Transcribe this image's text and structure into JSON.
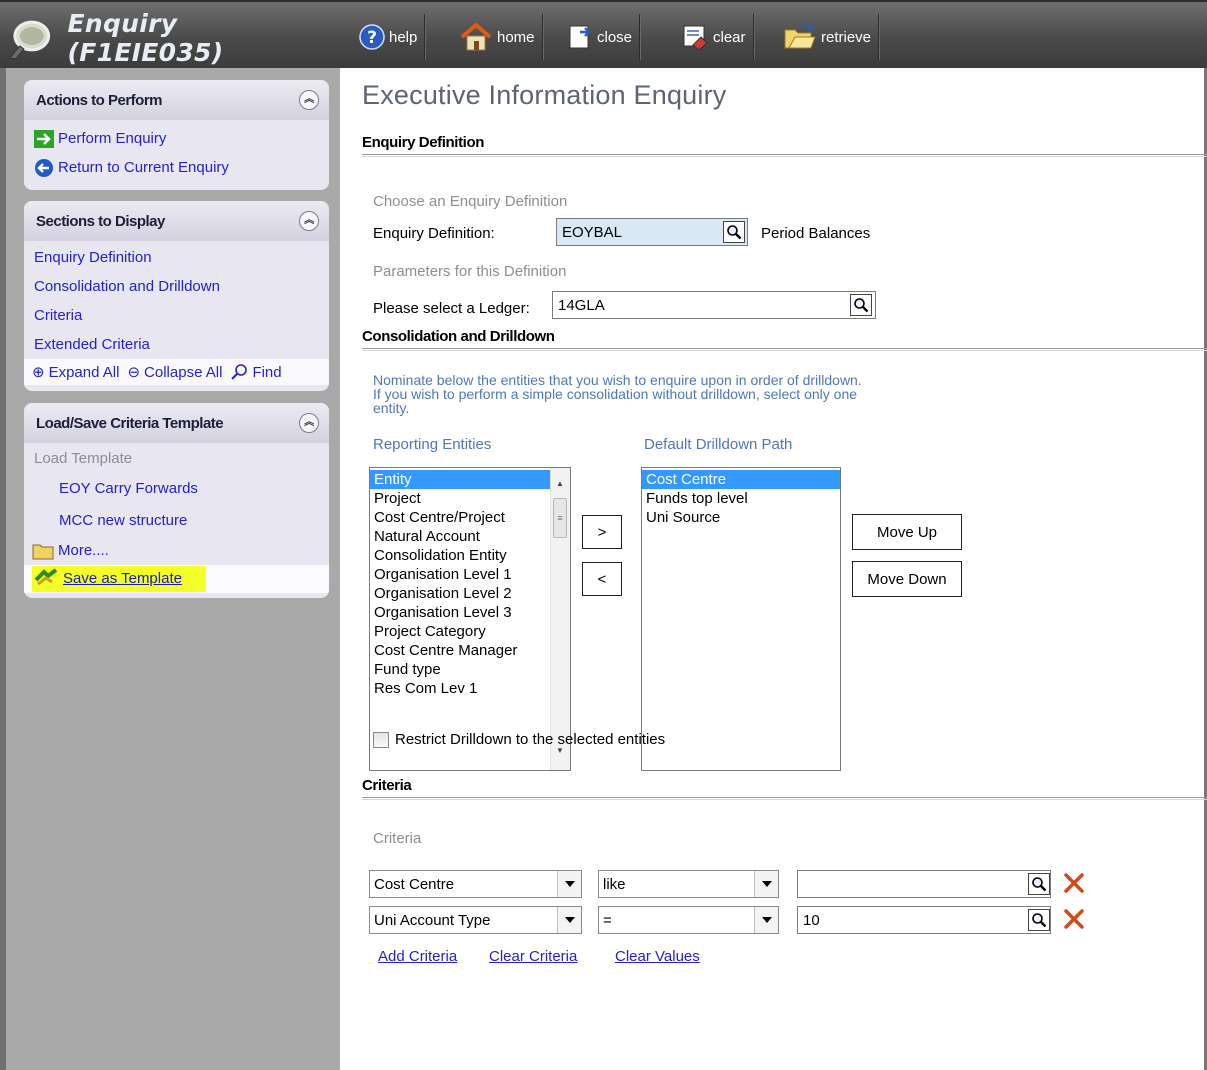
{
  "app": {
    "title": "Enquiry (F1EIE035)"
  },
  "toolbar": {
    "help": "help",
    "home": "home",
    "close": "close",
    "clear": "clear",
    "retrieve": "retrieve"
  },
  "sidebar": {
    "actions": {
      "header": "Actions to Perform",
      "perform": "Perform Enquiry",
      "return": "Return to Current Enquiry"
    },
    "sections": {
      "header": "Sections to Display",
      "items": [
        "Enquiry Definition",
        "Consolidation and Drilldown",
        "Criteria",
        "Extended Criteria"
      ],
      "expand_all": "Expand All",
      "collapse_all": "Collapse All",
      "find": "Find"
    },
    "templates": {
      "header": "Load/Save Criteria Template",
      "load_label": "Load Template",
      "items": [
        "EOY Carry Forwards",
        "MCC new structure"
      ],
      "more": "More....",
      "save": "Save as Template"
    }
  },
  "main": {
    "title": "Executive Information Enquiry",
    "enquiry_definition": {
      "heading": "Enquiry Definition",
      "choose_label": "Choose an Enquiry Definition",
      "field_label": "Enquiry Definition:",
      "field_value": "EOYBAL",
      "description": "Period Balances",
      "params_label": "Parameters for this Definition",
      "ledger_label": "Please select a Ledger:",
      "ledger_value": "14GLA"
    },
    "consolidation": {
      "heading": "Consolidation and Drilldown",
      "instructions_line1": "Nominate below the entities that you wish to enquire upon in order of drilldown.",
      "instructions_line2": "If you wish to perform a simple consolidation without drilldown, select only one",
      "instructions_line3": "entity.",
      "reporting_label": "Reporting Entities",
      "reporting_entities": [
        "Entity",
        "Project",
        "Cost Centre/Project",
        "Natural Account",
        "Consolidation Entity",
        "Organisation Level 1",
        "Organisation Level 2",
        "Organisation Level 3",
        "Project Category",
        "Cost Centre Manager",
        "Fund type",
        "Res Com Lev 1"
      ],
      "drilldown_label": "Default Drilldown Path",
      "drilldown_path": [
        "Cost Centre",
        "Funds top level",
        "Uni Source"
      ],
      "add_btn": ">",
      "remove_btn": "<",
      "move_up": "Move Up",
      "move_down": "Move Down",
      "restrict_label": "Restrict Drilldown to the selected entities",
      "restrict_checked": false
    },
    "criteria": {
      "heading": "Criteria",
      "sub_label": "Criteria",
      "rows": [
        {
          "field": "Cost Centre",
          "operator": "like",
          "value": ""
        },
        {
          "field": "Uni Account Type",
          "operator": "=",
          "value": "10"
        }
      ],
      "add": "Add Criteria",
      "clear_criteria": "Clear Criteria",
      "clear_values": "Clear Values"
    }
  },
  "colors": {
    "link": "#2323c8",
    "highlight": "#f4ff2a",
    "selection": "#3399ff",
    "remove_x": "#d24a17"
  }
}
